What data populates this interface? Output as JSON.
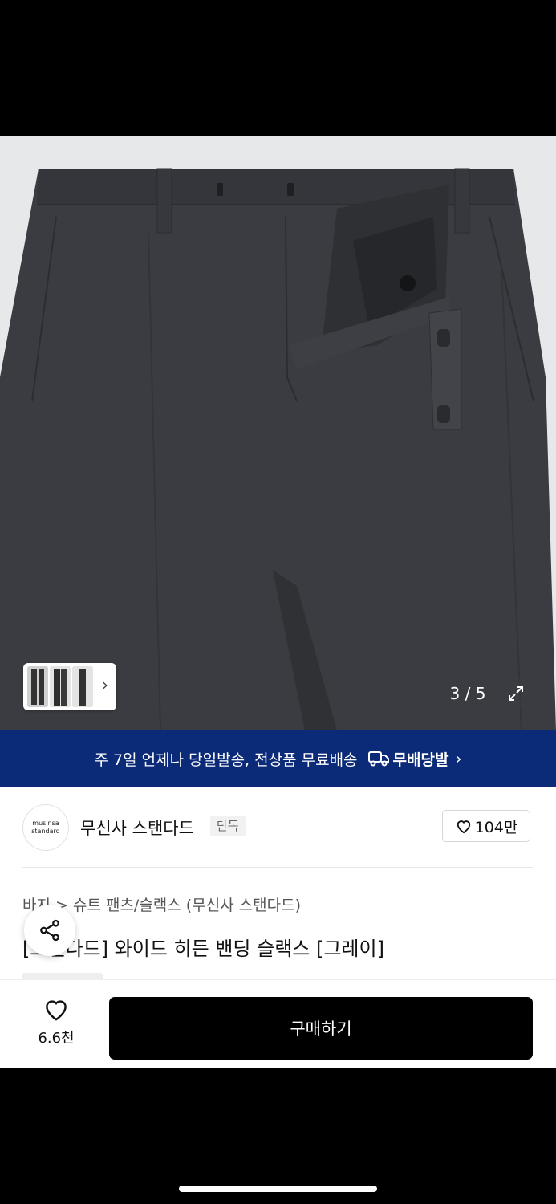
{
  "gallery": {
    "counter": "3 / 5",
    "icons": {
      "next": "chevron-right-icon",
      "expand": "expand-icon"
    }
  },
  "banner": {
    "text": "주 7일 언제나 당일발송, 전상품 무료배송",
    "badge_label": "무배당발",
    "chevron": "›"
  },
  "brand": {
    "logo_line1": "musinsa",
    "logo_line2": "standard",
    "name": "무신사 스탠다드",
    "tag": "단독",
    "likes": "104만"
  },
  "product": {
    "breadcrumb": "바지 > 슈트 팬츠/슬랙스 (무신사 스탠다드)",
    "title": "[스탠다드] 와이드 히든 밴딩 슬랙스 [그레이]"
  },
  "actionbar": {
    "wish_count": "6.6천",
    "buy_label": "구매하기"
  },
  "colors": {
    "banner": "#0b2a78",
    "pants": "#3a3c41",
    "buy_button": "#000000"
  }
}
